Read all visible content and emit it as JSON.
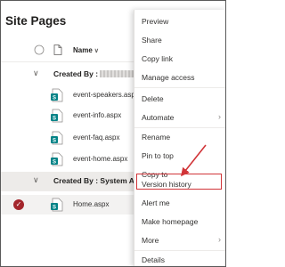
{
  "page": {
    "title": "Site Pages"
  },
  "list": {
    "column_header": "Name",
    "groups": [
      {
        "label": "Created By : ",
        "redacted": true
      },
      {
        "label": "Created By : System Ac"
      }
    ],
    "files": [
      {
        "name": "event-speakers.aspx"
      },
      {
        "name": "event-info.aspx"
      },
      {
        "name": "event-faq.aspx"
      },
      {
        "name": "event-home.aspx"
      },
      {
        "name": "Home.aspx"
      }
    ]
  },
  "menu": {
    "items": [
      {
        "label": "Preview"
      },
      {
        "label": "Share"
      },
      {
        "label": "Copy link"
      },
      {
        "label": "Manage access"
      },
      {
        "label": "Delete"
      },
      {
        "label": "Automate"
      },
      {
        "label": "Rename"
      },
      {
        "label": "Pin to top"
      },
      {
        "label": "Copy to"
      },
      {
        "label": "Version history"
      },
      {
        "label": "Alert me"
      },
      {
        "label": "Make homepage"
      },
      {
        "label": "More"
      },
      {
        "label": "Details"
      }
    ]
  },
  "colors": {
    "highlight": "#d13438",
    "page_icon": "#038387",
    "selected_check": "#a4262c"
  }
}
